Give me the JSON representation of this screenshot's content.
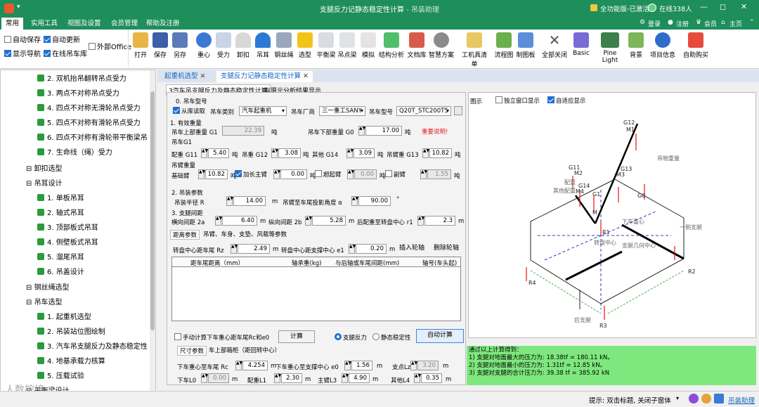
{
  "window": {
    "title": "支腿反力记静态稳定性计算",
    "subtitle": "- 吊装助理",
    "license": "全功能版-已激活",
    "online": "在线338人"
  },
  "window_controls": {
    "minimize": "—",
    "restore": "◻",
    "close": "✕"
  },
  "ribbon_tabs": [
    "常用",
    "实用工具",
    "视图及设置",
    "会员管理",
    "帮助及注册"
  ],
  "login": {
    "login": "登录",
    "register": "注册",
    "members": "会员",
    "home": "主页"
  },
  "options": {
    "autosave": "自动保存",
    "autoupdate": "自动更新",
    "external_office": "外部Office",
    "show_nav": "显示导航",
    "online_lib": "在线吊车库"
  },
  "ribbon_buttons": [
    "打开",
    "保存",
    "另存",
    "重心",
    "受力",
    "卸扣",
    "吊耳",
    "钢丝绳",
    "选型",
    "平衡梁",
    "吊点梁",
    "模拟",
    "结构分析",
    "文档库",
    "智慧方案",
    "工机具清单",
    "流程图",
    "制图板",
    "全部关闭",
    "Basic",
    "Pine Light",
    "背景",
    "项目信息",
    "自助购买"
  ],
  "tree": [
    {
      "label": "2. 双机抬吊翻转吊点受力",
      "type": "leaf"
    },
    {
      "label": "3. 两点不对称吊点受力",
      "type": "leaf"
    },
    {
      "label": "4. 四点不对称无滑轮吊点受力",
      "type": "leaf"
    },
    {
      "label": "5. 四点不对称有滑轮吊点受力",
      "type": "leaf"
    },
    {
      "label": "6. 四点不对称有滑轮带平衡梁吊",
      "type": "leaf"
    },
    {
      "label": "7. 生命线（绳）受力",
      "type": "leaf"
    },
    {
      "label": "卸扣选型",
      "type": "group"
    },
    {
      "label": "吊耳设计",
      "type": "group"
    },
    {
      "label": "1. 单板吊耳",
      "type": "leaf"
    },
    {
      "label": "2. 轴式吊耳",
      "type": "leaf"
    },
    {
      "label": "3. 顶部板式吊耳",
      "type": "leaf"
    },
    {
      "label": "4. 侧壁板式吊耳",
      "type": "leaf"
    },
    {
      "label": "5. 溜尾吊耳",
      "type": "leaf"
    },
    {
      "label": "6. 吊盖设计",
      "type": "leaf"
    },
    {
      "label": "钢丝绳选型",
      "type": "group"
    },
    {
      "label": "吊车选型",
      "type": "group"
    },
    {
      "label": "1. 起重机选型",
      "type": "leaf"
    },
    {
      "label": "2. 吊装站位图绘制",
      "type": "leaf"
    },
    {
      "label": "3. 汽车吊支腿反力及静态稳定性",
      "type": "leaf"
    },
    {
      "label": "4. 地基承载力核算",
      "type": "leaf"
    },
    {
      "label": "5. 压载试验",
      "type": "leaf"
    },
    {
      "label": "平衡梁设计",
      "type": "group"
    }
  ],
  "watermark": "人数控境",
  "doc_tabs": [
    "起重机选型",
    "支腿反力记静态稳定性计算"
  ],
  "sub_tabs": [
    "3汽车吊支腿反力及静态稳定性计算",
    "有限元分析结果显示"
  ],
  "crane": {
    "section": "0. 吊车型号",
    "from_lib": "从库读取",
    "type_label": "吊车类别",
    "type_value": "汽车起重机",
    "maker_label": "吊车厂商",
    "maker_value": "三一重工SANY",
    "model_label": "吊车型号",
    "model_value": "Q20T_STC200T5"
  },
  "weights": {
    "section": "1. 有效重量",
    "upper_label": "吊车上部重量 G1",
    "upper_value": "22.39",
    "unit_t": "吨",
    "lower_label": "吊车下部重量 G0",
    "lower_value": "17.00",
    "notice": "重要说明!",
    "g1_group": "吊车G1",
    "g11_label": "配重 G11",
    "g11_value": "5.40",
    "g12_label": "吊重 G12",
    "g12_value": "3.08",
    "g14_label": "其他 G14",
    "g14_value": "3.09",
    "g13_label": "吊臂重 G13",
    "g13_value": "10.82",
    "boom_group": "吊臂重量",
    "base_label": "基础臂",
    "base_value": "10.82",
    "add_main_label": "加长主臂",
    "add_main_value": "0.00",
    "super_label": "超起臂",
    "super_value": "0.00",
    "aux_label": "副臂",
    "aux_value": "1.55"
  },
  "lifting": {
    "section": "2. 吊装参数",
    "radius_label": "吊装半径 R",
    "radius_value": "14.00",
    "unit_m": "m",
    "angle_label": "吊臂至车尾投影角度 α",
    "angle_value": "90.00",
    "unit_deg": "°"
  },
  "outrigger": {
    "section": "3. 支腿间距",
    "h_label": "横向间距 2a",
    "h_value": "6.40",
    "v_label": "纵向间距 2b",
    "v_value": "5.28",
    "r1_label": "后配重至转盘中心 r1",
    "r1_value": "2.3"
  },
  "dist_tabs": [
    "距离参数",
    "吊臂、车身、支垫、风载等参数"
  ],
  "axle": {
    "rz_label": "转盘中心距车尾 Rz",
    "rz_value": "2.49",
    "e1_label": "转盘中心距支撑中心 e1",
    "e1_value": "0.20",
    "insert_btn": "插入轮轴",
    "delete_btn": "删除轮轴",
    "columns": [
      "距车尾距离（mm）",
      "轴承重(kg)",
      "与后轴或车尾间距(mm)",
      "轴号(车头起)"
    ]
  },
  "calc": {
    "manual_label": "手动计算下车重心距车尾Rc和e0",
    "calc_btn": "计算",
    "radio_reaction": "支腿反力",
    "radio_stability": "静态稳定性",
    "auto_btn": "自动计算"
  },
  "dim_tabs": [
    "尺寸参数",
    "车上部箱柜（距回转中心）"
  ],
  "dims": {
    "rc_label": "下车重心至车尾 Rc",
    "rc_value": "4.254",
    "e0_label": "下车重心至支撑中心 e0",
    "e0_value": "1.56",
    "lz_label": "支点Lz",
    "lz_value": "3.20",
    "l0_label": "下车L0",
    "l0_value": "0.00",
    "l1_label": "配重L1",
    "l1_value": "2.30",
    "l3_label": "主臂L3",
    "l3_value": "4.90",
    "l4_label": "其他L4",
    "l4_value": "0.35"
  },
  "figure": {
    "title": "图示",
    "independent": "独立窗口显示",
    "adaptive": "自适应显示",
    "labels": {
      "g12": "G12",
      "m1": "M1",
      "g11": "G11",
      "m2": "M2",
      "g14": "G14",
      "m4": "M4",
      "g1": "G1",
      "g13": "G13",
      "m3": "M3",
      "g0": "G0",
      "m": "M",
      "r1": "R1",
      "r2": "R2",
      "r3": "R3",
      "r4": "R4",
      "load": "吊物重量",
      "other": "其他配重",
      "counterweight": "配重",
      "center": "转盘中心",
      "support": "支腿几何中心",
      "lower_cg": "下车重心",
      "one_leg": "一侧支腿",
      "rear_leg": "后支腿"
    }
  },
  "results": {
    "header": "通过以上计算得到：",
    "lines": [
      "1) 支腿对地面最大的压力为: 18.38tf = 180.11 kN。",
      "2) 支腿对地面最小的压力为: 1.31tf = 12.85 kN。",
      "3) 支腿对支腿的合计压力为: 39.38 tf = 385.92 kN"
    ]
  },
  "status": {
    "hint": "提示: 双击标题, 关闭子窗体",
    "brand": "吊装助理"
  },
  "colors": {
    "title_green": "#1e8e5a",
    "result_green": "#7ee87e",
    "notice_red": "#e02020"
  }
}
